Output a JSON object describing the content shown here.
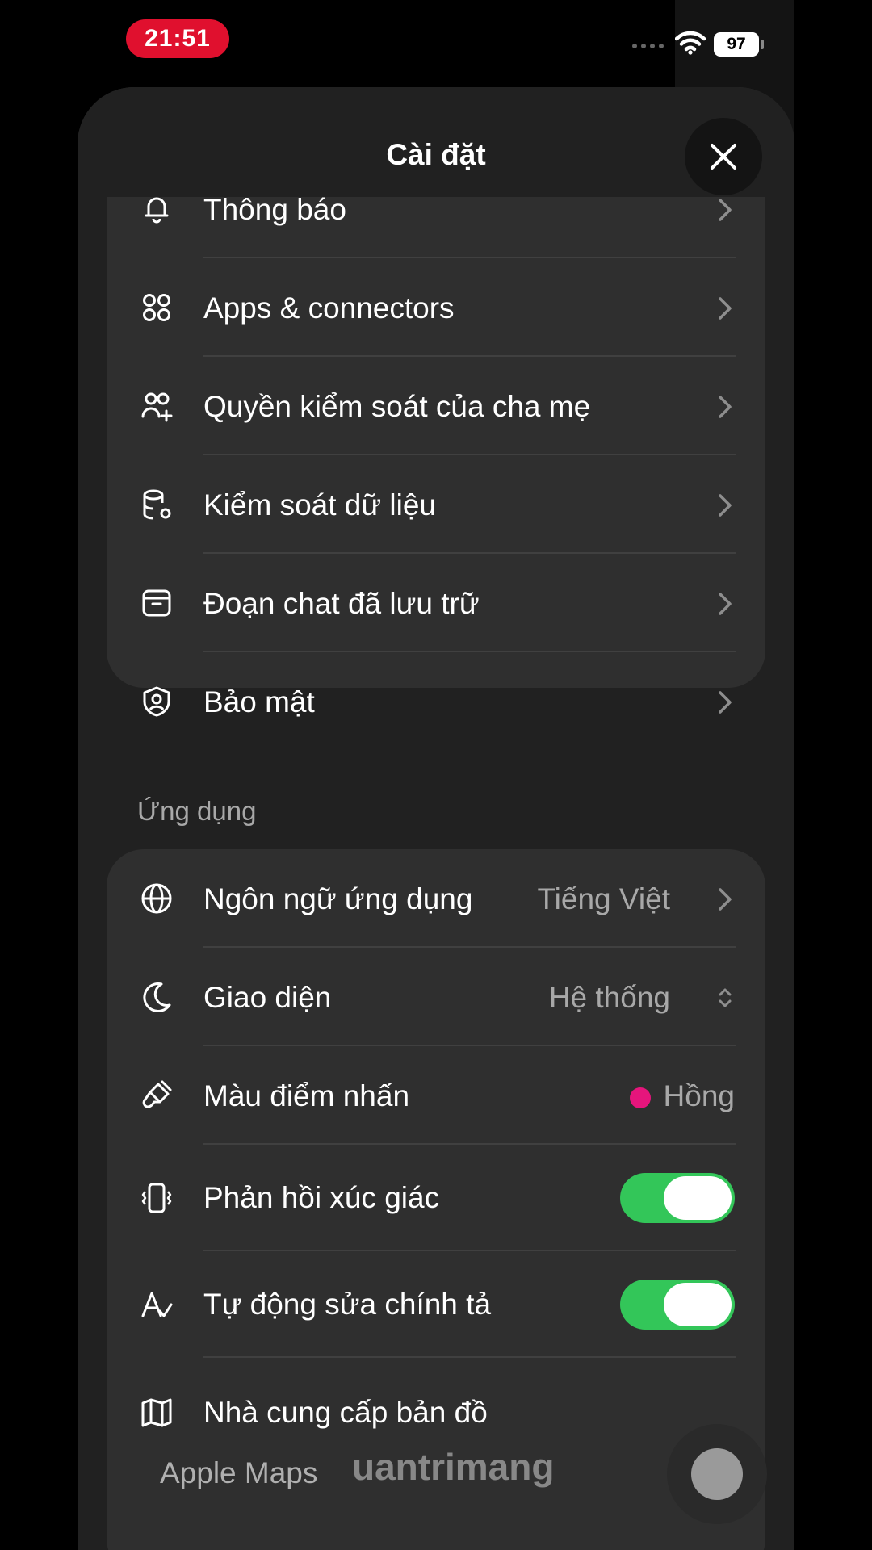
{
  "status_bar": {
    "time": "21:51",
    "battery": "97"
  },
  "header": {
    "title": "Cài đặt"
  },
  "account_group": {
    "items": [
      {
        "label": "Thông báo",
        "icon": "bell-icon"
      },
      {
        "label": "Apps & connectors",
        "icon": "apps-icon"
      },
      {
        "label": "Quyền kiểm soát của cha mẹ",
        "icon": "parents-icon"
      },
      {
        "label": "Kiểm soát dữ liệu",
        "icon": "database-settings-icon"
      },
      {
        "label": "Đoạn chat đã lưu trữ",
        "icon": "archive-icon"
      },
      {
        "label": "Bảo mật",
        "icon": "shield-user-icon"
      }
    ]
  },
  "app_section": {
    "label": "Ứng dụng",
    "language": {
      "label": "Ngôn ngữ ứng dụng",
      "value": "Tiếng Việt"
    },
    "appearance": {
      "label": "Giao diện",
      "value": "Hệ thống"
    },
    "accent": {
      "label": "Màu điểm nhấn",
      "value": "Hồng",
      "color": "#e6157c"
    },
    "haptics": {
      "label": "Phản hồi xúc giác",
      "on": true
    },
    "autocorrect": {
      "label": "Tự động sửa chính tả",
      "on": true
    },
    "map_provider": {
      "label": "Nhà cung cấp bản đồ",
      "value": "Apple Maps"
    }
  },
  "watermark": "uantrimang",
  "colors": {
    "toggle_on": "#33c659",
    "status_time_bg": "#e0102e"
  }
}
